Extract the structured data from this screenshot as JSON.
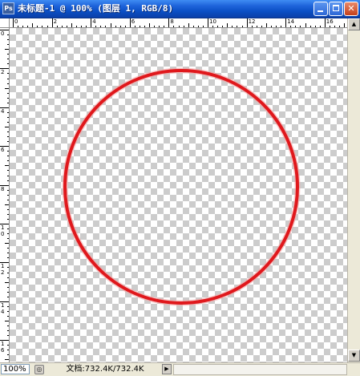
{
  "window": {
    "app_icon_label": "Ps",
    "title": "未标题-1 @ 100% (图层 1, RGB/8)"
  },
  "window_controls": {
    "minimize_icon": "minimize-icon",
    "maximize_icon": "maximize-icon",
    "close_label": "✕"
  },
  "rulers": {
    "horizontal_labels": [
      "0",
      "2",
      "4",
      "6",
      "8",
      "10",
      "12",
      "14",
      "16"
    ],
    "vertical_labels": [
      [
        "0"
      ],
      [
        "2"
      ],
      [
        "4"
      ],
      [
        "6"
      ],
      [
        "8"
      ],
      [
        "1",
        "0"
      ],
      [
        "1",
        "2"
      ],
      [
        "1",
        "4"
      ],
      [
        "1",
        "6"
      ]
    ]
  },
  "canvas": {
    "background": "transparency-checkerboard",
    "shape": "circle-outline",
    "stroke_color": "#e0181c"
  },
  "statusbar": {
    "zoom": "100%",
    "doc_info": "文档:732.4K/732.4K",
    "menu_arrow": "▶"
  },
  "scrollbar": {
    "up_arrow": "▲",
    "down_arrow": "▼"
  }
}
